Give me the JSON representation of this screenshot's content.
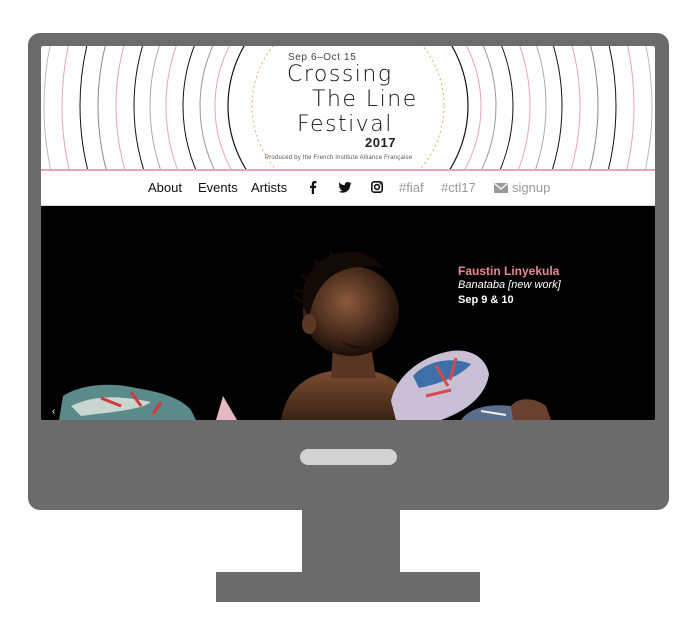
{
  "header": {
    "dates": "Sep 6–Oct 15",
    "title_line1": "Crossing",
    "title_line2": "The Line",
    "title_line3": "Festival",
    "year": "2017",
    "produced_by": "Produced by the French Institute Alliance Française"
  },
  "nav": {
    "about": "About",
    "events": "Events",
    "artists": "Artists",
    "facebook_icon": "facebook-icon",
    "twitter_icon": "twitter-icon",
    "instagram_icon": "instagram-icon",
    "hashtag_fiaf": "#fiaf",
    "hashtag_ctl17": "#ctl17",
    "signup_icon": "envelope-icon",
    "signup": "signup"
  },
  "hero": {
    "artist": "Faustin Linyekula",
    "work": "Banataba [new work]",
    "dates": "Sep 9 & 10"
  },
  "colors": {
    "accent_pink": "#e8899b",
    "monitor_grey": "#6b6b6b",
    "nav_grey": "#9a9a9a"
  }
}
